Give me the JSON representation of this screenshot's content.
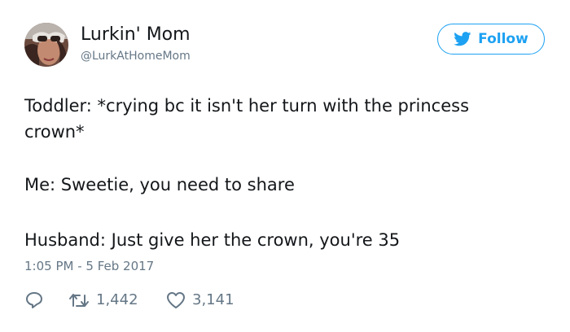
{
  "author": {
    "display_name": "Lurkin' Mom",
    "handle": "@LurkAtHomeMom",
    "avatar_icon": "avatar-photo"
  },
  "follow": {
    "label": "Follow",
    "icon": "bird-icon",
    "color": "#1da1f2"
  },
  "tweet": {
    "lines": [
      "Toddler: *crying bc it isn't her turn with the princess",
      "crown*",
      "Me: Sweetie, you need to share",
      "Husband: Just give her the crown, you're 35"
    ],
    "timestamp": "1:05 PM - 5 Feb 2017"
  },
  "actions": {
    "reply_icon": "reply-icon",
    "retweet_icon": "retweet-icon",
    "retweet_count": "1,442",
    "like_icon": "heart-icon",
    "like_count": "3,141",
    "icon_color": "#657786"
  }
}
